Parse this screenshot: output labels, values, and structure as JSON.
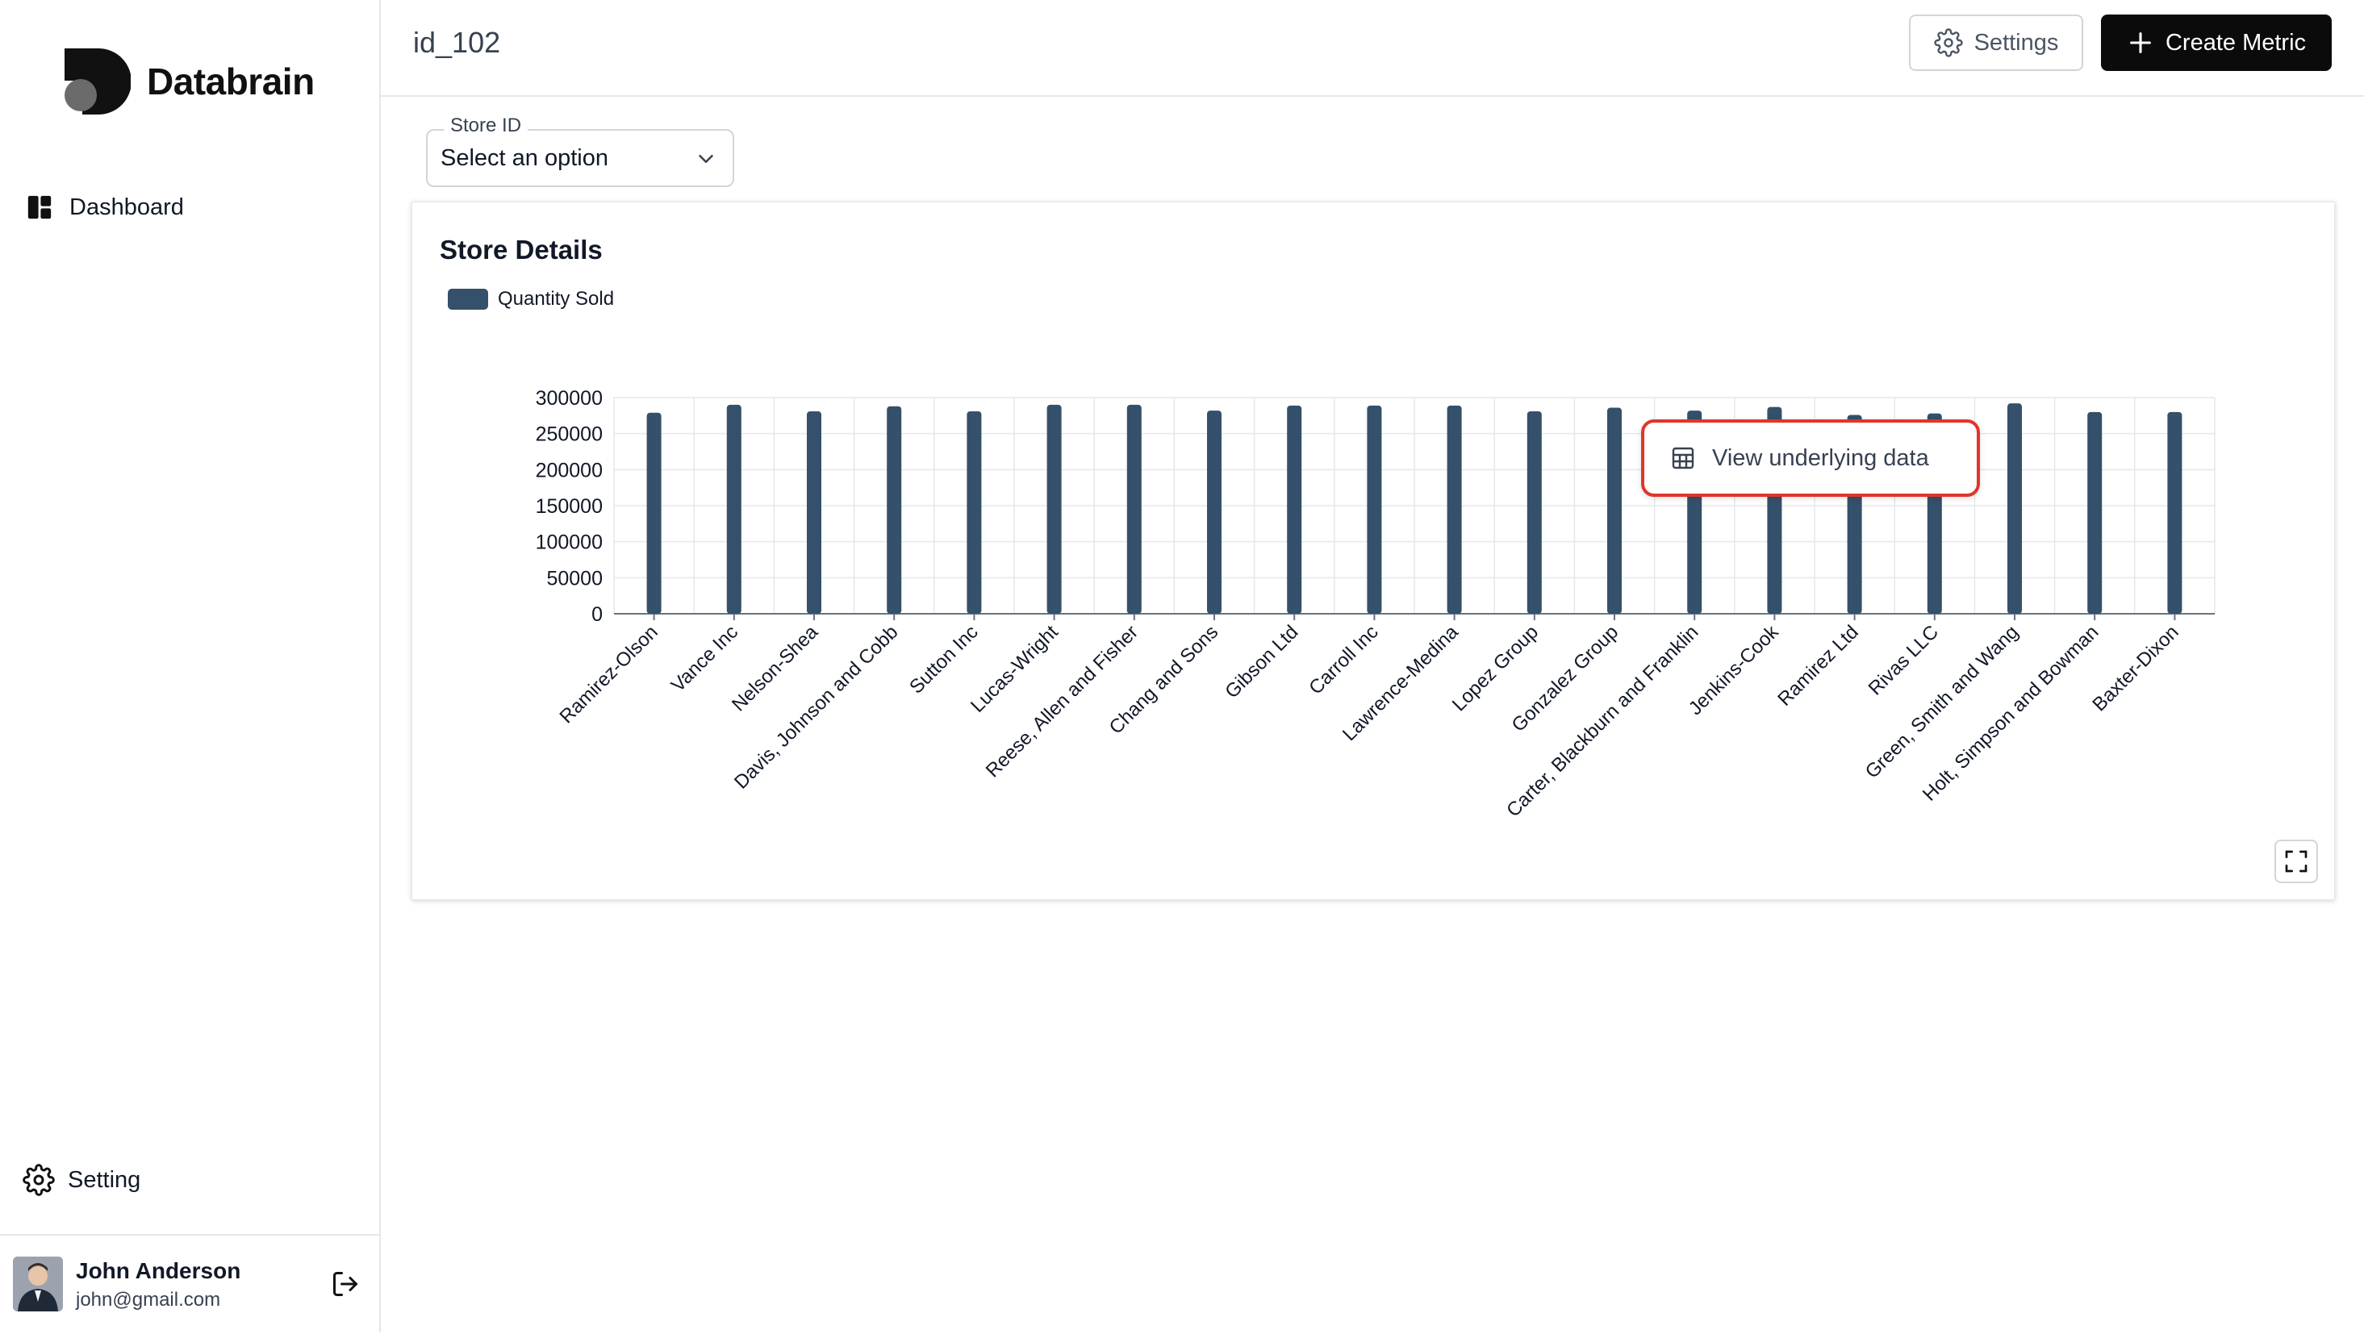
{
  "brand": {
    "name": "Databrain"
  },
  "sidebar": {
    "items": [
      {
        "label": "Dashboard",
        "icon": "dashboard-icon"
      }
    ],
    "setting_label": "Setting"
  },
  "user": {
    "name": "John Anderson",
    "email": "john@gmail.com"
  },
  "header": {
    "title": "id_102",
    "settings_label": "Settings",
    "create_label": "Create Metric"
  },
  "filter": {
    "legend": "Store ID",
    "value": "Select an option"
  },
  "card": {
    "title": "Store Details"
  },
  "context_menu": {
    "label": "View underlying data"
  },
  "chart_data": {
    "type": "bar",
    "title": "Store Details",
    "series": [
      {
        "name": "Quantity Sold",
        "color": "#34506a",
        "values": [
          279000,
          290000,
          281000,
          288000,
          281000,
          290000,
          290000,
          282000,
          289000,
          289000,
          289000,
          281000,
          286000,
          282000,
          287000,
          276000,
          278000,
          292000,
          280000,
          280000
        ]
      }
    ],
    "categories": [
      "Ramirez-Olson",
      "Vance Inc",
      "Nelson-Shea",
      "Davis, Johnson and Cobb",
      "Sutton Inc",
      "Lucas-Wright",
      "Reese, Allen and Fisher",
      "Chang and Sons",
      "Gibson Ltd",
      "Carroll Inc",
      "Lawrence-Medina",
      "Lopez Group",
      "Gonzalez Group",
      "Carter, Blackburn and Franklin",
      "Jenkins-Cook",
      "Ramirez Ltd",
      "Rivas LLC",
      "Green, Smith and Wang",
      "Holt, Simpson and Bowman",
      "Baxter-Dixon"
    ],
    "yticks": [
      "300000",
      "250000",
      "200000",
      "150000",
      "100000",
      "50000",
      "0"
    ],
    "ylim": [
      0,
      300000
    ],
    "grid": true,
    "legend": "top-left"
  }
}
